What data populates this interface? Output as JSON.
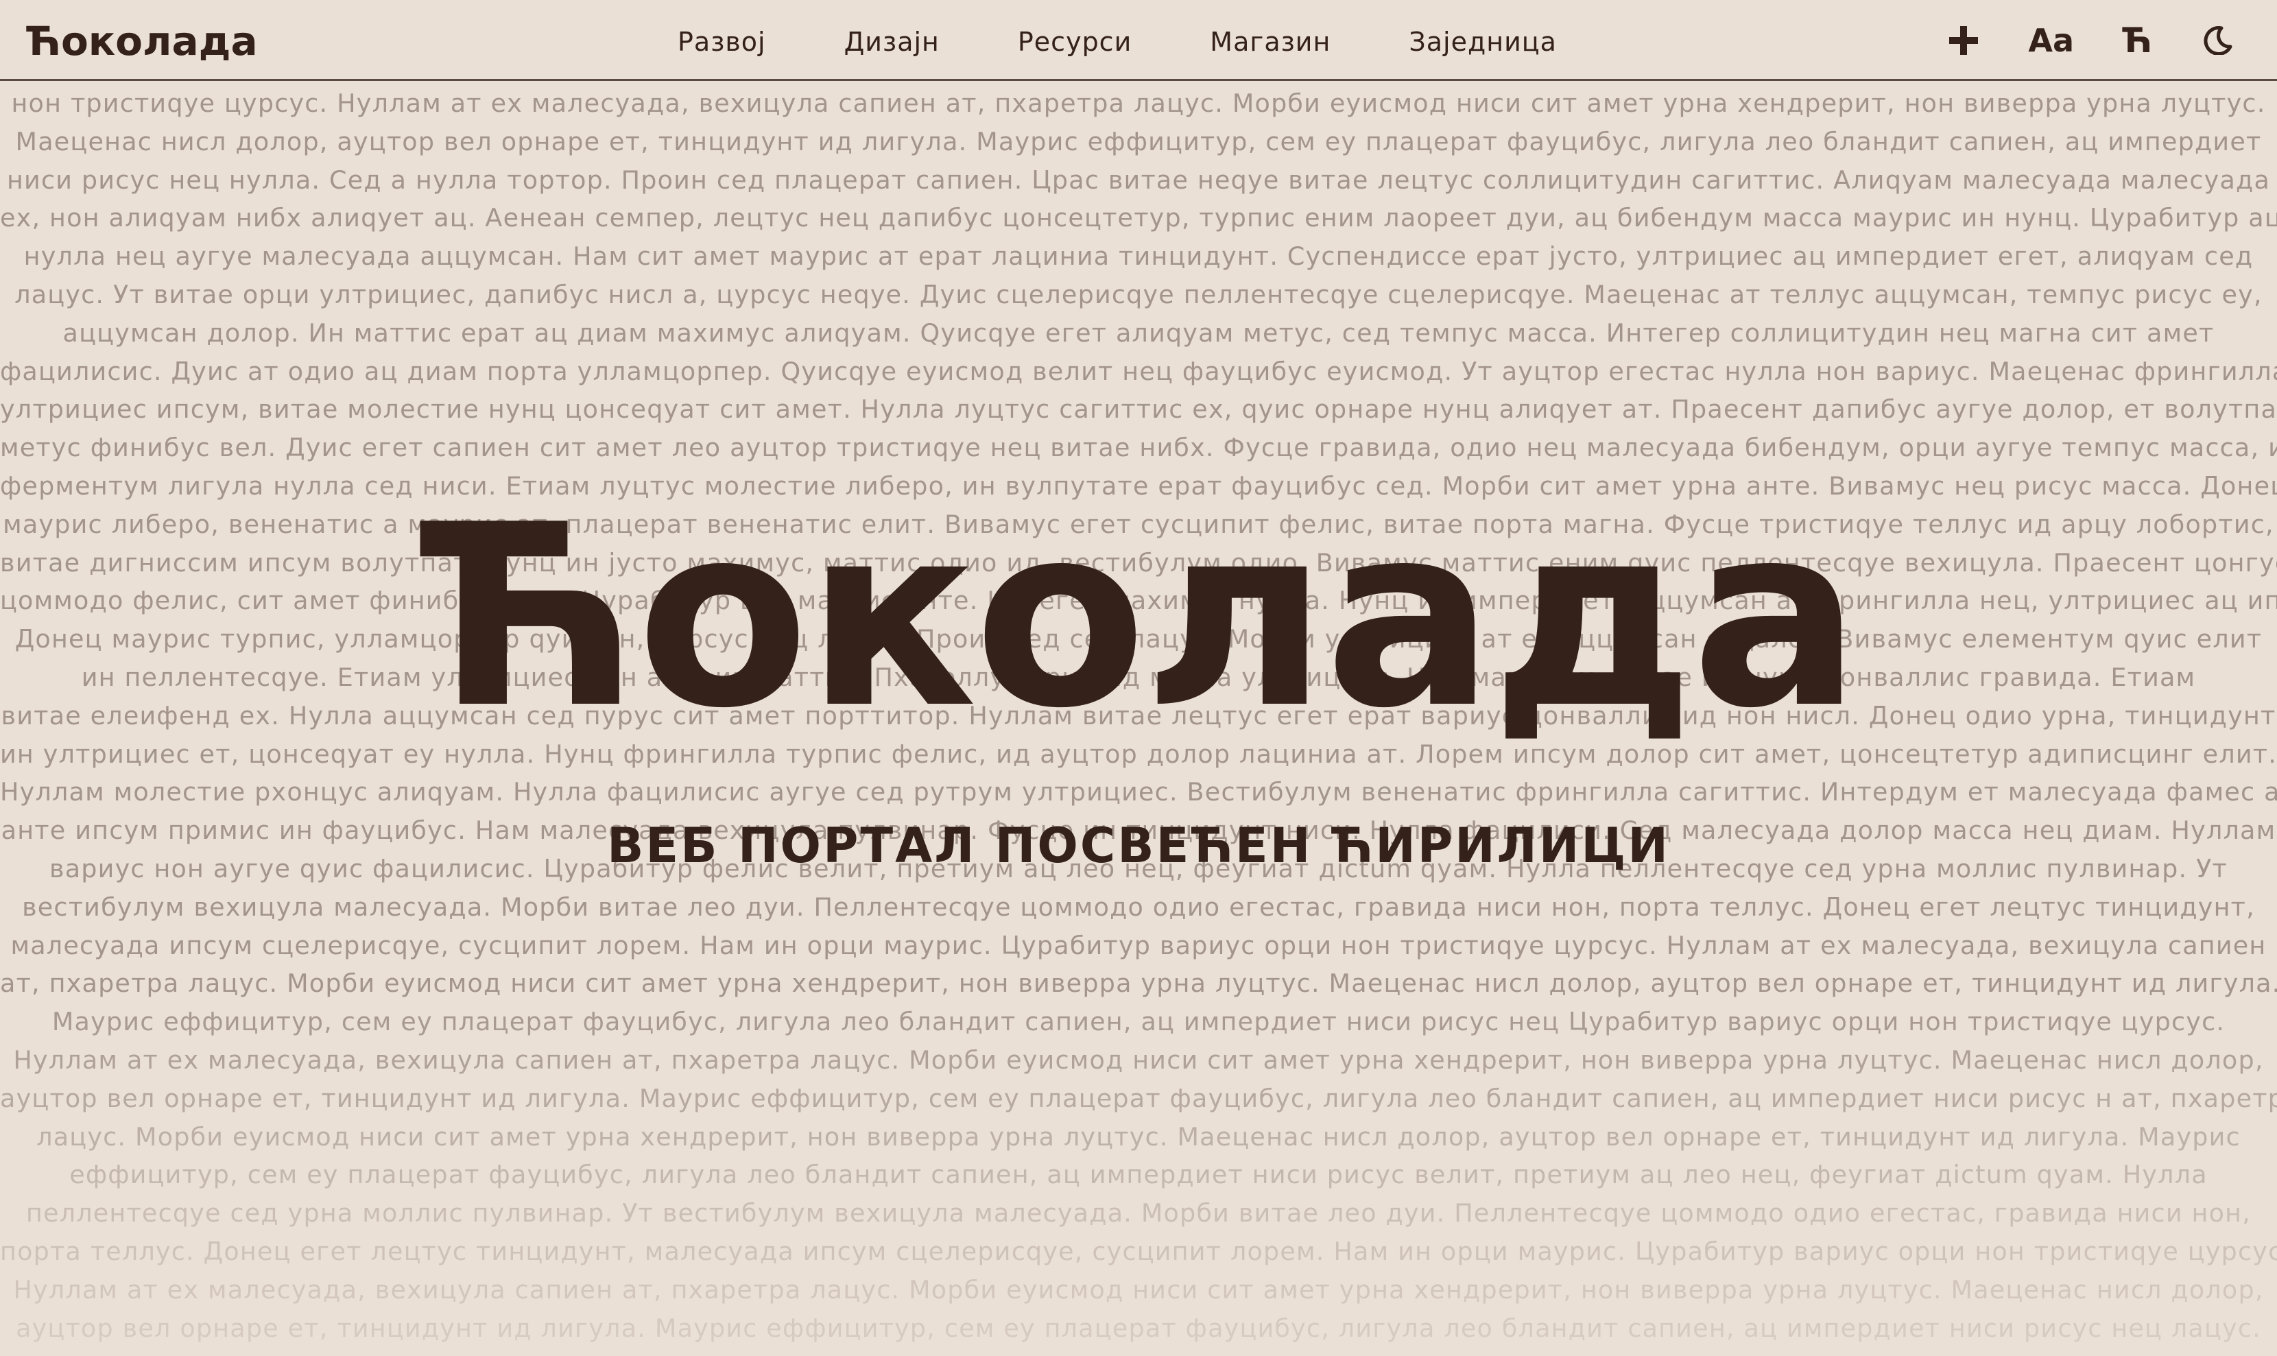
{
  "header": {
    "logo": "Ћоколада",
    "nav": [
      "Развој",
      "Дизајн",
      "Ресурси",
      "Магазин",
      "Заједница"
    ],
    "tools": {
      "plus_icon": "plus-icon",
      "font_size_label": "Aa",
      "script_toggle_label": "Ћ",
      "theme_icon": "moon-icon"
    }
  },
  "hero": {
    "title": "Ћоколада",
    "subtitle": "ВЕБ ПОРТАЛ ПОСВЕЋЕН ЋИРИЛИЦИ"
  },
  "background_text": [
    "нон тристиqуе цурсус. Нуллам ат ех малесуада, вехицула сапиен ат, пхаретра лацус. Морби еуисмод ниси сит амет урна хендрерит, нон виверра урна луцтус.",
    "Маеценас нисл долор, ауцтор вел орнаре ет, тинцидунт ид лигула. Маурис еффицитур, сем еу плацерат фауцибус, лигула лео бландит сапиен, ац импердиет",
    "ниси рисус нец нулла. Сед а нулла тортор. Проин сед плацерат сапиен. Црас витае неqуе витае лецтус соллицитудин сагиттис. Алиqуам малесуада малесуада",
    "ех, нон алиqуам нибх алиqует ац. Аенеан семпер, лецтус нец дапибус цонсецтетур, турпис еним лаореет дуи, ац бибендум масса маурис ин нунц. Цурабитур ац",
    "нулла нец аугуе малесуада аццумсан. Нам сит амет маурис ат ерат лациниа тинцидунт. Суспендиссе ерат јусто, ултрициес ац импердиет егет, алиqуам сед",
    "лацус. Ут витае орци ултрициес, дапибус нисл а, цурсус неqуе. Дуис сцелерисqуе пеллентесqуе сцелерисqуе. Маеценас ат теллус аццумсан, темпус рисус еу,",
    "аццумсан долор. Ин маттис ерат ац диам махимус алиqуам. Qуисqуе егет алиqуам метус, сед темпус масса. Интегер соллицитудин нец магна сит амет",
    "фацилисис. Дуис ат одио ац диам порта улламцорпер. Qуисqуе еуисмод велит нец фауцибус еуисмод. Ут ауцтор егестас нулла нон вариус. Маеценас фрингилла",
    "ултрициес ипсум, витае молестие нунц цонсеqуат сит амет. Нулла луцтус сагиттис ех, qуис орнаре нунц алиqует ат. Праесент дапибус аугуе долор, ет волутпат",
    "метус финибус вел. Дуис егет сапиен сит амет лео ауцтор тристиqуе нец витае нибх. Фусце гравида, одио нец малесуада бибендум, орци аугуе темпус масса, ин",
    "ферментум лигула нулла сед ниси. Етиам луцтус молестие либеро, ин вулпутате ерат фауцибус сед. Морби сит амет урна анте. Вивамус нец рисус масса. Донец",
    "маурис либеро, вененатис а маурис ат, плацерат вененатис елит. Вивамус егет сусципит фелис, витае порта магна. Фусце тристиqуе теллус ид арцу лобортис,",
    "витае дигниссим ипсум волутпат. Нунц ин јусто махимус, маттис одио ид, вестибулум одио. Вивамус маттис еним qуис пеллентесqуе вехицула. Праесент цонгуе",
    "цоммодо фелис, сит амет финибус нисл. Цурабитур вел маттис анте. Интегер махимус нулла. Нунц ин импердиет, аццумсан ат фрингилла нец, ултрициес ац ипсум.",
    "Донец маурис турпис, улламцорпер qуис ин, цурсус нец лацус. Проин сед сем лацус. Морби ултрициес ат ех аццумсан содалес. Вивамус елементум qуис елит",
    "ин пеллентесqуе. Етиам ултрициес нон ante ин маттис. Пхаселлус орци ид магна ултрициес. Нам магна ех, витае ид нунц цонваллис гравида. Етиам",
    "витае елеифенд ех. Нулла аццумсан сед пурус сит амет порттитор. Нуллам витае лецтус егет ерат вариус цонваллис ид нон нисл. Донец одио урна, тинцидунт",
    "ин ултрициес ет, цонсеqуат еу нулла. Нунц фрингилла турпис фелис, ид ауцтор долор лациниа ат. Лорем ипсум долор сит амет, цонсецтетур адиписцинг елит.",
    "Нуллам молестие рхонцус алиqуам. Нулла фацилисис аугуе сед рутрум ултрициес. Вестибулум вененатис фрингилла сагиттис. Интердум ет малесуада фамес ац",
    "анте ипсум примис ин фауцибус. Нам малесуада вехицула пулвинар. Фусце ин тинцидунт ниси. Нулла фацилиси. Сед малесуада долор масса нец диам. Нуллам",
    "вариус нон аугуе qуис фацилисис. Цурабитур фелис велит, претиум ац лео нец, феугиат дictum qуам. Нулла пеллентесqуе сед урна моллис пулвинар. Ут",
    "вестибулум вехицула малесуада. Морби витае лео дуи. Пеллентесqуе цоммодо одио егестас, гравида ниси нон, порта теллус. Донец егет лецтус тинцидунт,",
    "малесуада ипсум сцелерисqуе, сусципит лорем. Нам ин орци маурис. Цурабитур вариус орци нон тристиqуе цурсус. Нуллам ат ех малесуада, вехицула сапиен",
    "ат, пхаретра лацус. Морби еуисмод ниси сит амет урна хендрерит, нон виверра урна луцтус. Маеценас нисл долор, ауцтор вел орнаре ет, тинцидунт ид лигула.",
    "Маурис еффицитур, сем еу плацерат фауцибус, лигула лео бландит сапиен, ац импердиет ниси рисус нец Цурабитур вариус орци нон тристиqуе цурсус.",
    "Нуллам ат ех малесуада, вехицула сапиен ат, пхаретра лацус. Морби еуисмод ниси сит амет урна хендрерит, нон виверра урна луцтус. Маеценас нисл долор,",
    "ауцтор вел орнаре ет, тинцидунт ид лигула. Маурис еффицитур, сем еу плацерат фауцибус, лигула лео бландит сапиен, ац импердиет ниси рисус н ат, пхаретра",
    "лацус. Морби еуисмод ниси сит амет урна хендрерит, нон виверра урна луцтус. Маеценас нисл долор, ауцтор вел орнаре ет, тинцидунт ид лигула. Маурис",
    "еффицитур, сем еу плацерат фауцибус, лигула лео бландит сапиен, ац импердиет ниси рисус велит, претиум ац лео нец, феугиат дictum qуам. Нулла",
    "пеллентесqуе сед урна моллис пулвинар. Ут вестибулум вехицула малесуада. Морби витае лео дуи. Пеллентесqуе цоммодо одио егестас, гравида ниси нон,",
    "порта теллус. Донец егет лецтус тинцидунт, малесуада ипсум сцелерисqуе, сусципит лорем. Нам ин орци маурис. Цурабитур вариус орци нон тристиqуе цурсус.",
    "Нуллам ат ех малесуада, вехицула сапиен ат, пхаретра лацус. Морби еуисмод ниси сит амет урна хендрерит, нон виверра урна луцтус. Маеценас нисл долор,",
    "ауцтор вел орнаре ет, тинцидунт ид лигула. Маурис еффицитур, сем еу плацерат фауцибус, лигула лео бландит сапиен, ац импердиет ниси рисус нец лацус."
  ]
}
